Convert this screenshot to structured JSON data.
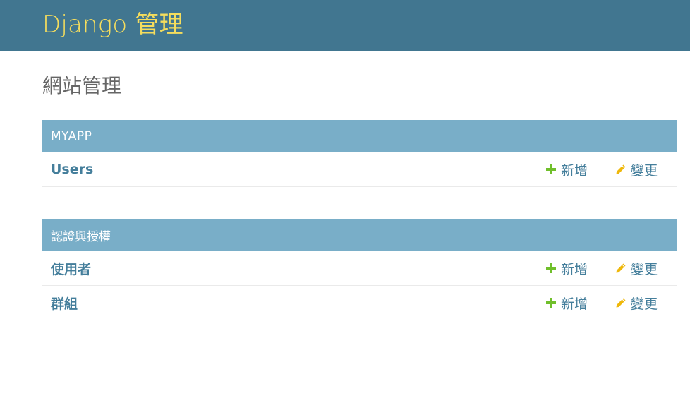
{
  "header": {
    "branding": "Django 管理"
  },
  "page": {
    "title": "網站管理"
  },
  "modules": [
    {
      "caption": "MYAPP",
      "rows": [
        {
          "name": "Users",
          "add_label": "新增",
          "change_label": "變更"
        }
      ]
    },
    {
      "caption": "認證與授權",
      "rows": [
        {
          "name": "使用者",
          "add_label": "新增",
          "change_label": "變更"
        },
        {
          "name": "群組",
          "add_label": "新增",
          "change_label": "變更"
        }
      ]
    }
  ],
  "icons": {
    "add": "plus-icon",
    "change": "pencil-icon"
  },
  "colors": {
    "header_bg": "#417690",
    "branding": "#f5dd5d",
    "module_caption_bg": "#79aec8",
    "link": "#447e9b",
    "add_icon": "#70bf2b",
    "change_icon": "#efb80b"
  }
}
